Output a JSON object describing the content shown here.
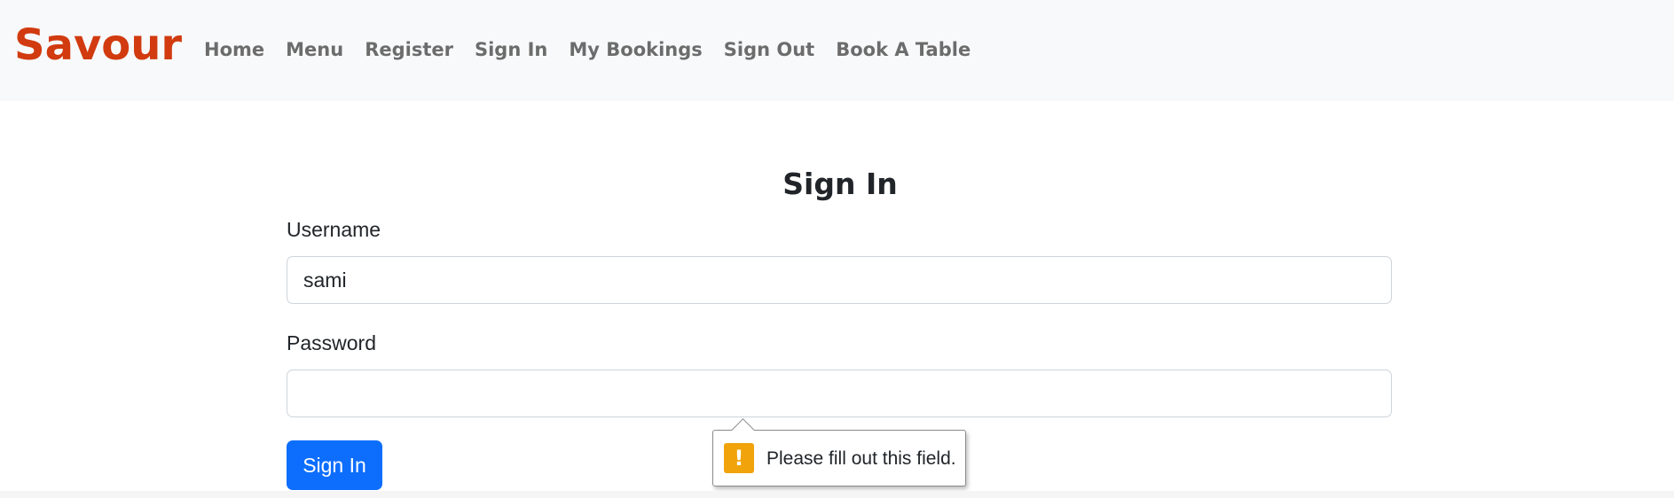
{
  "navbar": {
    "brand": "Savour",
    "links": [
      "Home",
      "Menu",
      "Register",
      "Sign In",
      "My Bookings",
      "Sign Out",
      "Book A Table"
    ]
  },
  "form": {
    "title": "Sign In",
    "username_label": "Username",
    "username_value": "sami",
    "password_label": "Password",
    "password_value": "",
    "submit_label": "Sign In"
  },
  "validation": {
    "message": "Please fill out this field.",
    "icon": "warning-icon"
  },
  "colors": {
    "brand": "#d13b0f",
    "primary_button": "#0d6efd",
    "navbar_bg": "#f8f9fa",
    "warning": "#f0a30a"
  }
}
